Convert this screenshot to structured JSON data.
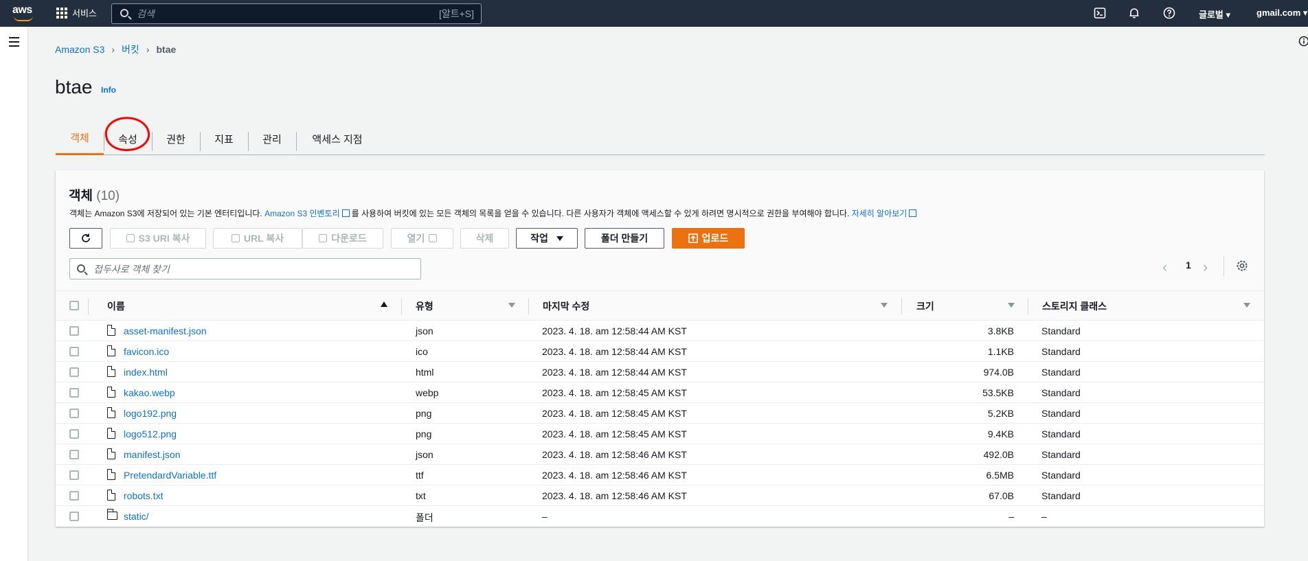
{
  "nav": {
    "logo": "aws",
    "services": "서비스",
    "search_placeholder": "검색",
    "search_shortcut": "[알트+S]",
    "region": "글로벌 ▾",
    "account": "gmail.com ▾"
  },
  "breadcrumb": {
    "s3": "Amazon S3",
    "buckets": "버킷",
    "current": "btae"
  },
  "page": {
    "title": "btae",
    "info": "Info"
  },
  "tabs": [
    "객체",
    "속성",
    "권한",
    "지표",
    "관리",
    "액세스 지점"
  ],
  "objects": {
    "title": "객체",
    "count": "(10)",
    "desc_1": "객체는 Amazon S3에 저장되어 있는 기본 엔터티입니다.",
    "desc_link1": "Amazon S3 인벤토리",
    "desc_2": "를 사용하여 버킷에 있는 모든 객체의 목록을 얻을 수 있습니다. 다른 사용자가 객체에 액세스할 수 있게 하려면 명시적으로 권한을 부여해야 합니다.",
    "desc_link2": "자세히 알아보기",
    "buttons": {
      "copy_s3_uri": "S3 URI 복사",
      "copy_url": "URL 복사",
      "download": "다운로드",
      "open": "열기",
      "delete": "삭제",
      "actions": "작업",
      "create_folder": "폴더 만들기",
      "upload": "업로드"
    },
    "filter_placeholder": "접두사로 객체 찾기",
    "page": "1",
    "columns": [
      "이름",
      "유형",
      "마지막 수정",
      "크기",
      "스토리지 클래스"
    ],
    "rows": [
      {
        "name": "asset-manifest.json",
        "type": "json",
        "modified": "2023. 4. 18. am 12:58:44 AM KST",
        "size": "3.8KB",
        "class": "Standard",
        "kind": "file"
      },
      {
        "name": "favicon.ico",
        "type": "ico",
        "modified": "2023. 4. 18. am 12:58:44 AM KST",
        "size": "1.1KB",
        "class": "Standard",
        "kind": "file"
      },
      {
        "name": "index.html",
        "type": "html",
        "modified": "2023. 4. 18. am 12:58:44 AM KST",
        "size": "974.0B",
        "class": "Standard",
        "kind": "file"
      },
      {
        "name": "kakao.webp",
        "type": "webp",
        "modified": "2023. 4. 18. am 12:58:45 AM KST",
        "size": "53.5KB",
        "class": "Standard",
        "kind": "file"
      },
      {
        "name": "logo192.png",
        "type": "png",
        "modified": "2023. 4. 18. am 12:58:45 AM KST",
        "size": "5.2KB",
        "class": "Standard",
        "kind": "file"
      },
      {
        "name": "logo512.png",
        "type": "png",
        "modified": "2023. 4. 18. am 12:58:45 AM KST",
        "size": "9.4KB",
        "class": "Standard",
        "kind": "file"
      },
      {
        "name": "manifest.json",
        "type": "json",
        "modified": "2023. 4. 18. am 12:58:46 AM KST",
        "size": "492.0B",
        "class": "Standard",
        "kind": "file"
      },
      {
        "name": "PretendardVariable.ttf",
        "type": "ttf",
        "modified": "2023. 4. 18. am 12:58:46 AM KST",
        "size": "6.5MB",
        "class": "Standard",
        "kind": "file"
      },
      {
        "name": "robots.txt",
        "type": "txt",
        "modified": "2023. 4. 18. am 12:58:46 AM KST",
        "size": "67.0B",
        "class": "Standard",
        "kind": "file"
      },
      {
        "name": "static/",
        "type": "폴더",
        "modified": "–",
        "size": "–",
        "class": "–",
        "kind": "folder"
      }
    ]
  },
  "colors": {
    "nav_bg": "#232f3e",
    "accent": "#ec7211",
    "link": "#0972d3",
    "annotation": "#ff0000"
  }
}
